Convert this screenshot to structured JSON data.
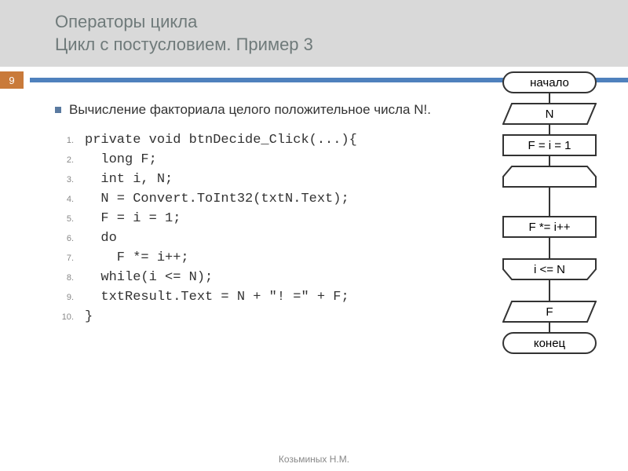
{
  "header": {
    "title_line1": "Операторы цикла",
    "title_line2": "Цикл c постусловием. Пример 3"
  },
  "page_number": "9",
  "intro_text": "Вычисление факториала целого положительное числа N!.",
  "code_lines": [
    "private void btnDecide_Click(...){",
    "  long F;",
    "  int i, N;",
    "  N = Convert.ToInt32(txtN.Text);",
    "  F = i = 1;",
    "  do",
    "    F *= i++;",
    "  while(i <= N);",
    "  txtResult.Text = N + \"! =\" + F;",
    "}"
  ],
  "flowchart": {
    "start": "начало",
    "input": "N",
    "init": "F = i = 1",
    "loop_body": "F *= i++",
    "loop_cond": "i <= N",
    "output": "F",
    "end": "конец"
  },
  "footer": "Козьминых Н.М.",
  "chart_data": {
    "type": "flowchart",
    "nodes": [
      {
        "id": "start",
        "shape": "terminator",
        "label": "начало"
      },
      {
        "id": "in",
        "shape": "io",
        "label": "N"
      },
      {
        "id": "init",
        "shape": "process",
        "label": "F = i = 1"
      },
      {
        "id": "loop-begin",
        "shape": "loop-top",
        "label": ""
      },
      {
        "id": "body",
        "shape": "process",
        "label": "F *= i++"
      },
      {
        "id": "loop-end",
        "shape": "loop-bottom",
        "label": "i <= N"
      },
      {
        "id": "out",
        "shape": "io",
        "label": "F"
      },
      {
        "id": "end",
        "shape": "terminator",
        "label": "конец"
      }
    ],
    "edges": [
      [
        "start",
        "in"
      ],
      [
        "in",
        "init"
      ],
      [
        "init",
        "loop-begin"
      ],
      [
        "loop-begin",
        "body"
      ],
      [
        "body",
        "loop-end"
      ],
      [
        "loop-end",
        "loop-begin"
      ],
      [
        "loop-end",
        "out"
      ],
      [
        "out",
        "end"
      ]
    ]
  }
}
